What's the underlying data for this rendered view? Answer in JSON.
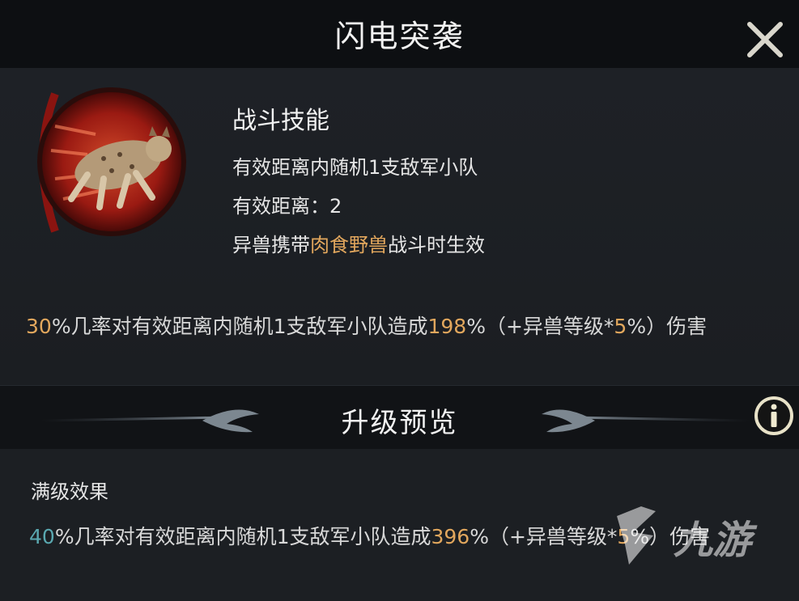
{
  "header": {
    "title": "闪电突袭"
  },
  "skill": {
    "type": "战斗技能",
    "target_line": "有效距离内随机1支敌军小队",
    "range_line": "有效距离：2",
    "cond_prefix": "异兽携带",
    "cond_highlight": "肉食野兽",
    "cond_suffix": "战斗时生效",
    "desc": {
      "chance": "30",
      "part1": "%几率对有效距离内随机1支敌军小队造成",
      "damage": "198",
      "part2": "%（+异兽等级*",
      "level_factor": "5",
      "part3": "%）伤害"
    }
  },
  "upgrade": {
    "title": "升级预览",
    "max_label": "满级效果",
    "desc": {
      "chance": "40",
      "part1": "%几率对有效距离内随机1支敌军小队造成",
      "damage": "396",
      "part2": "%（+异兽等级*",
      "level_factor": "5",
      "part3": "%）伤害"
    }
  },
  "watermark": {
    "text": "九游"
  },
  "colors": {
    "gold": "#e2a75d",
    "teal": "#5aa8b0",
    "header_bg": "#0d0f12",
    "panel_bg": "#1e2126"
  },
  "icons": {
    "close": "close-icon",
    "info": "info-icon",
    "skill": "lynx-skill-icon"
  }
}
